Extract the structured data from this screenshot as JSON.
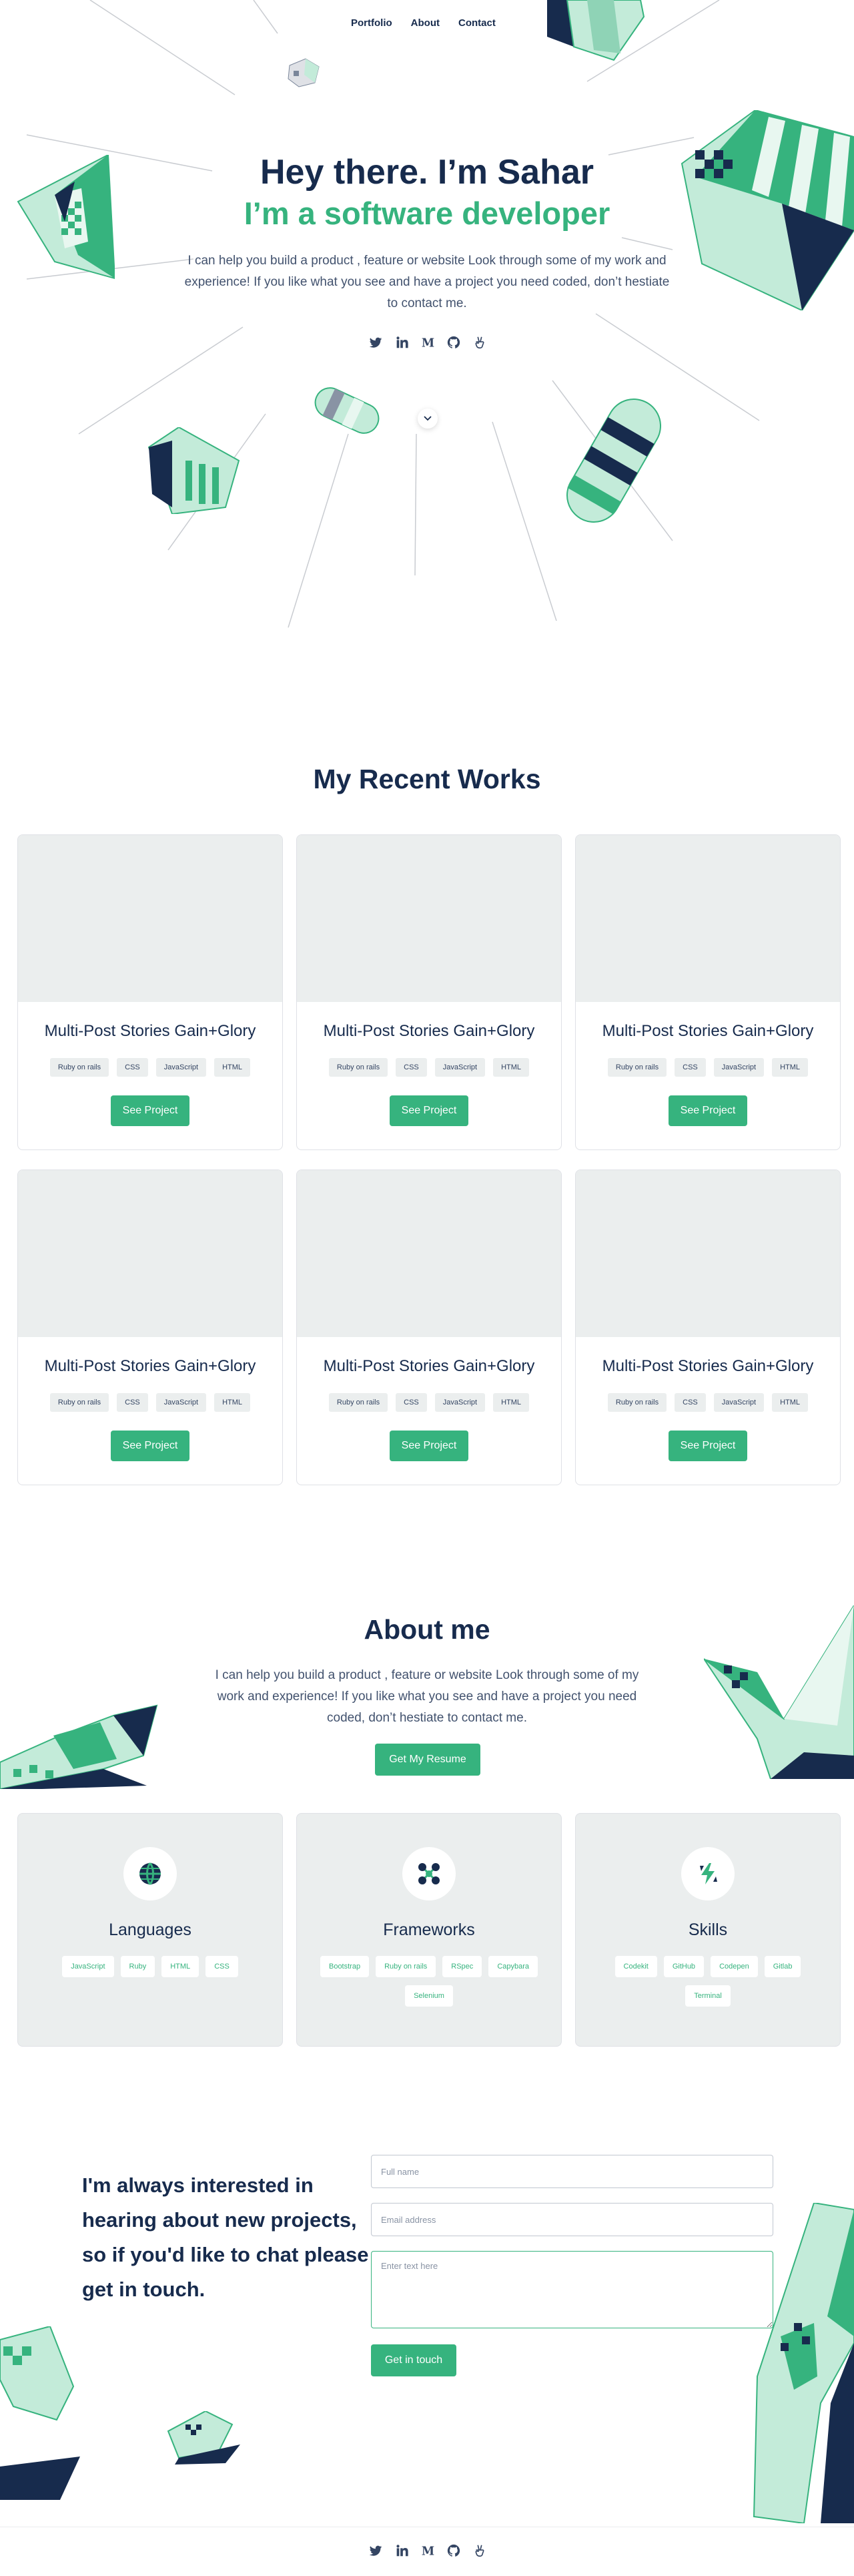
{
  "nav": {
    "items": [
      {
        "label": "Portfolio"
      },
      {
        "label": "About"
      },
      {
        "label": "Contact"
      }
    ]
  },
  "hero": {
    "title": "Hey there. I’m Sahar",
    "subtitle": "I’m a software developer",
    "text": "I can help you build a product , feature or website Look through some of my work and experience! If you like what you see and have a project you need coded, don’t hestiate to contact me."
  },
  "socials": [
    "twitter-icon",
    "linkedin-icon",
    "medium-icon",
    "github-icon",
    "angellist-icon"
  ],
  "works": {
    "title": "My Recent Works",
    "projects": [
      {
        "title": "Multi-Post Stories Gain+Glory",
        "tags": [
          "Ruby on rails",
          "CSS",
          "JavaScript",
          "HTML"
        ],
        "button": "See Project"
      },
      {
        "title": "Multi-Post Stories Gain+Glory",
        "tags": [
          "Ruby on rails",
          "CSS",
          "JavaScript",
          "HTML"
        ],
        "button": "See Project"
      },
      {
        "title": "Multi-Post Stories Gain+Glory",
        "tags": [
          "Ruby on rails",
          "CSS",
          "JavaScript",
          "HTML"
        ],
        "button": "See Project"
      },
      {
        "title": "Multi-Post Stories Gain+Glory",
        "tags": [
          "Ruby on rails",
          "CSS",
          "JavaScript",
          "HTML"
        ],
        "button": "See Project"
      },
      {
        "title": "Multi-Post Stories Gain+Glory",
        "tags": [
          "Ruby on rails",
          "CSS",
          "JavaScript",
          "HTML"
        ],
        "button": "See Project"
      },
      {
        "title": "Multi-Post Stories Gain+Glory",
        "tags": [
          "Ruby on rails",
          "CSS",
          "JavaScript",
          "HTML"
        ],
        "button": "See Project"
      }
    ]
  },
  "about": {
    "title": "About me",
    "text": "I can help you build a product , feature or website Look through some of my work and experience! If you like what you see and have a project you need coded, don’t hestiate to contact me.",
    "resume_button": "Get My Resume",
    "cards": [
      {
        "title": "Languages",
        "icon": "globe-icon",
        "tags": [
          "JavaScript",
          "Ruby",
          "HTML",
          "CSS"
        ]
      },
      {
        "title": "Frameworks",
        "icon": "molecule-icon",
        "tags": [
          "Bootstrap",
          "Ruby on rails",
          "RSpec",
          "Capybara",
          "Selenium"
        ]
      },
      {
        "title": "Skills",
        "icon": "bolt-icon",
        "tags": [
          "Codekit",
          "GitHub",
          "Codepen",
          "Gitlab",
          "Terminal"
        ]
      }
    ]
  },
  "contact": {
    "heading": "I'm always interested in hearing about new projects, so if you'd like to chat please get in touch.",
    "fullname_placeholder": "Full name",
    "email_placeholder": "Email address",
    "message_placeholder": "Enter text here",
    "button": "Get in touch"
  },
  "colors": {
    "navy": "#172b4d",
    "green": "#36b37e",
    "light_green": "#c3ebd9",
    "card_grey": "#ebeeee"
  }
}
